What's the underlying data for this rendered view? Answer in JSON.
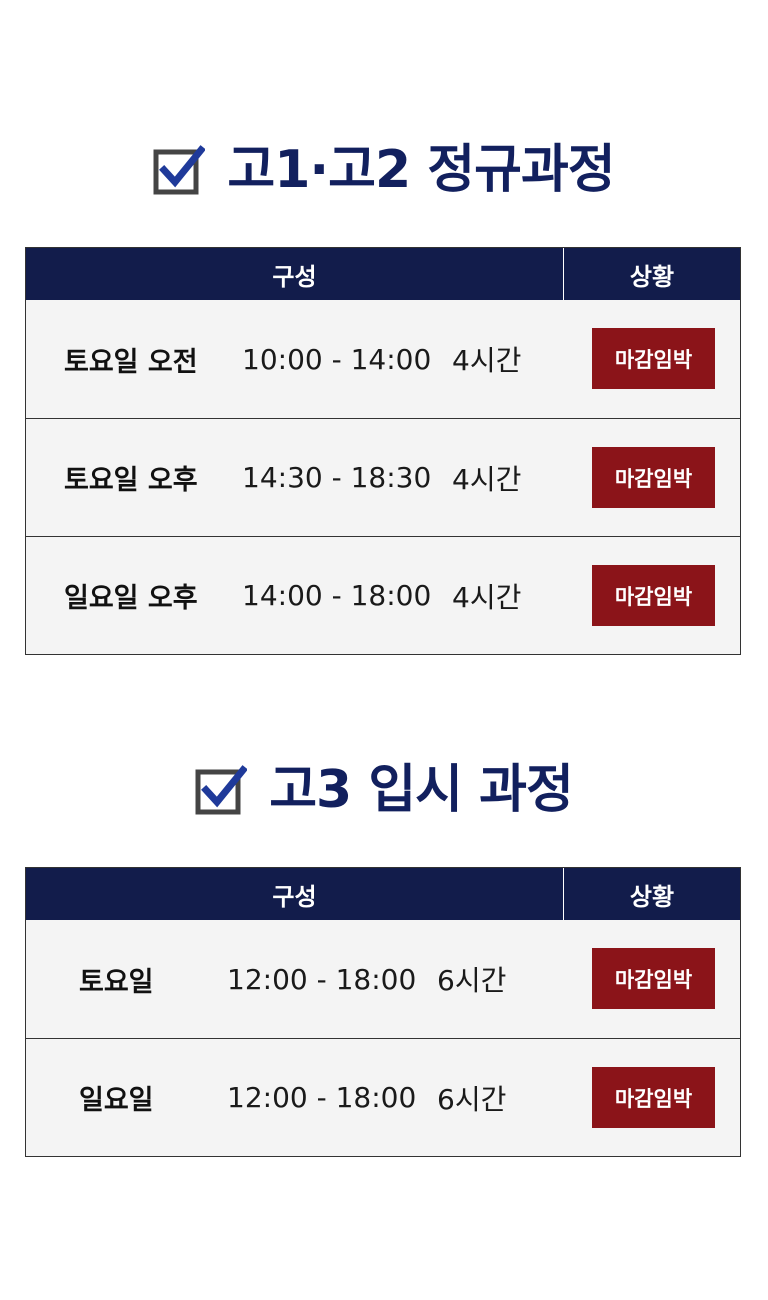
{
  "sections": [
    {
      "title": "고1·고2 정규과정",
      "header": {
        "config": "구성",
        "status": "상황"
      },
      "rows": [
        {
          "day": "토요일 오전",
          "time": "10:00 - 14:00",
          "hours": "4시간",
          "status": "마감임박"
        },
        {
          "day": "토요일 오후",
          "time": "14:30 - 18:30",
          "hours": "4시간",
          "status": "마감임박"
        },
        {
          "day": "일요일 오후",
          "time": "14:00 - 18:00",
          "hours": "4시간",
          "status": "마감임박"
        }
      ]
    },
    {
      "title": "고3 입시 과정",
      "header": {
        "config": "구성",
        "status": "상황"
      },
      "rows": [
        {
          "day": "토요일",
          "time": "12:00 - 18:00",
          "hours": "6시간",
          "status": "마감임박"
        },
        {
          "day": "일요일",
          "time": "12:00 - 18:00",
          "hours": "6시간",
          "status": "마감임박"
        }
      ]
    }
  ],
  "colors": {
    "title": "#12205e",
    "header_bg": "#121c4b",
    "status_bg": "#8b1419",
    "row_bg": "#f4f4f4",
    "check_mark": "#1f3a9a",
    "check_box": "#444444"
  },
  "icons": {
    "section_check": "checkbox-checked-icon"
  }
}
